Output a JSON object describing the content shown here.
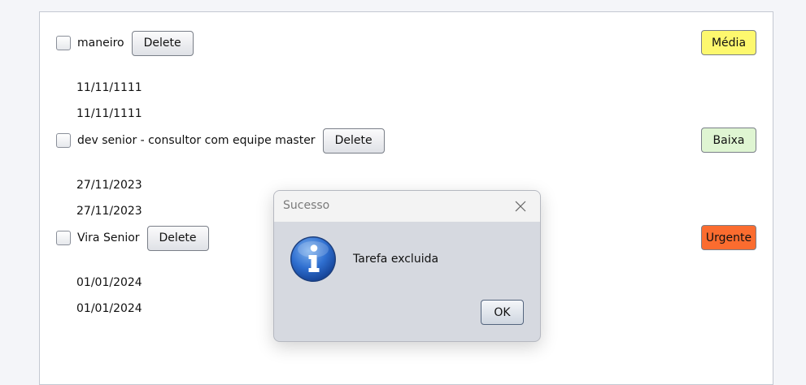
{
  "tasks": [
    {
      "title": "maneiro",
      "delete_label": "Delete",
      "date_start": "11/11/1111",
      "date_end": "11/11/1111",
      "priority": "Média",
      "priority_color": "#fdf86e"
    },
    {
      "title": "dev senior - consultor com equipe master",
      "delete_label": "Delete",
      "date_start": "27/11/2023",
      "date_end": "27/11/2023",
      "priority": "Baixa",
      "priority_color": "#dff5d2"
    },
    {
      "title": "Vira Senior",
      "delete_label": "Delete",
      "date_start": "01/01/2024",
      "date_end": "01/01/2024",
      "priority": "Urgente",
      "priority_color": "#fb6c2f"
    }
  ],
  "dialog": {
    "title": "Sucesso",
    "message": "Tarefa excluida",
    "ok_label": "OK",
    "icon": "info-icon",
    "close_icon": "close-icon"
  }
}
